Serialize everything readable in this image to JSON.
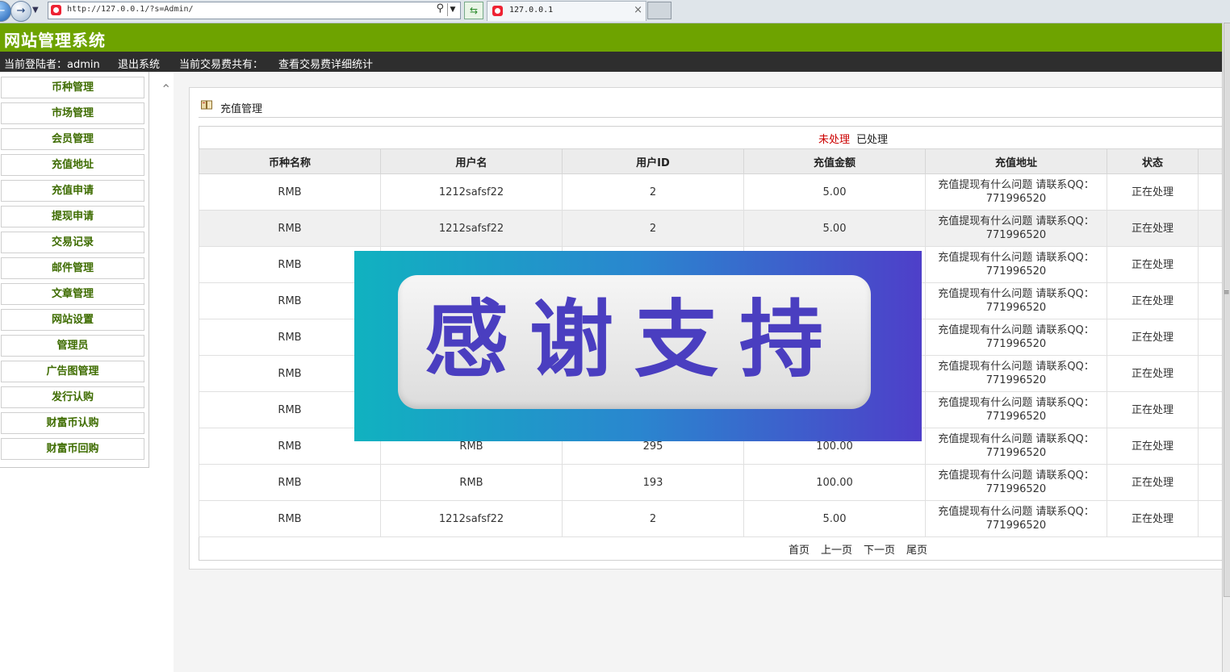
{
  "browser": {
    "url": "http://127.0.0.1/?s=Admin/",
    "tab_title": "127.0.0.1",
    "tab_close": "×"
  },
  "header": {
    "site_title": "网站管理系统"
  },
  "userbar": {
    "current_user": "当前登陆者：admin",
    "logout": "退出系统",
    "fee_total": "当前交易费共有：",
    "fee_detail": "查看交易费详细统计"
  },
  "sidebar": {
    "items": [
      {
        "label": "币种管理"
      },
      {
        "label": "市场管理"
      },
      {
        "label": "会员管理"
      },
      {
        "label": "充值地址"
      },
      {
        "label": "充值申请"
      },
      {
        "label": "提现申请"
      },
      {
        "label": "交易记录"
      },
      {
        "label": "邮件管理"
      },
      {
        "label": "文章管理"
      },
      {
        "label": "网站设置"
      },
      {
        "label": "管理员"
      },
      {
        "label": "广告图管理"
      },
      {
        "label": "发行认购"
      },
      {
        "label": "财富币认购"
      },
      {
        "label": "财富币回购"
      }
    ]
  },
  "panel": {
    "title": "充值管理",
    "filter_active": "未处理",
    "filter_other": "已处理"
  },
  "table": {
    "columns": [
      "币种名称",
      "用户名",
      "用户ID",
      "充值金额",
      "充值地址",
      "状态"
    ],
    "rows": [
      [
        "RMB",
        "1212safsf22",
        "2",
        "5.00",
        "充值提现有什么问题 请联系QQ：771996520",
        "正在处理"
      ],
      [
        "RMB",
        "1212safsf22",
        "2",
        "5.00",
        "充值提现有什么问题 请联系QQ：771996520",
        "正在处理"
      ],
      [
        "RMB",
        "",
        "",
        "",
        "充值提现有什么问题 请联系QQ：771996520",
        "正在处理"
      ],
      [
        "RMB",
        "",
        "",
        "",
        "充值提现有什么问题 请联系QQ：771996520",
        "正在处理"
      ],
      [
        "RMB",
        "",
        "",
        "",
        "充值提现有什么问题 请联系QQ：771996520",
        "正在处理"
      ],
      [
        "RMB",
        "",
        "",
        "",
        "充值提现有什么问题 请联系QQ：771996520",
        "正在处理"
      ],
      [
        "RMB",
        "",
        "",
        "",
        "充值提现有什么问题 请联系QQ：771996520",
        "正在处理"
      ],
      [
        "RMB",
        "RMB",
        "295",
        "100.00",
        "充值提现有什么问题 请联系QQ：771996520",
        "正在处理"
      ],
      [
        "RMB",
        "RMB",
        "193",
        "100.00",
        "充值提现有什么问题 请联系QQ：771996520",
        "正在处理"
      ],
      [
        "RMB",
        "1212safsf22",
        "2",
        "5.00",
        "充值提现有什么问题 请联系QQ：771996520",
        "正在处理"
      ]
    ]
  },
  "pager": {
    "first": "首页",
    "prev": "上一页",
    "next": "下一页",
    "last": "尾页"
  },
  "ad": {
    "text": "感谢支持"
  },
  "colors": {
    "header_green": "#6ea300",
    "userbar_dark": "#2e2e2e",
    "menu_text_green": "#3e6c00",
    "filter_red": "#cc0000",
    "ad_text_purple": "#4a3ec0"
  }
}
